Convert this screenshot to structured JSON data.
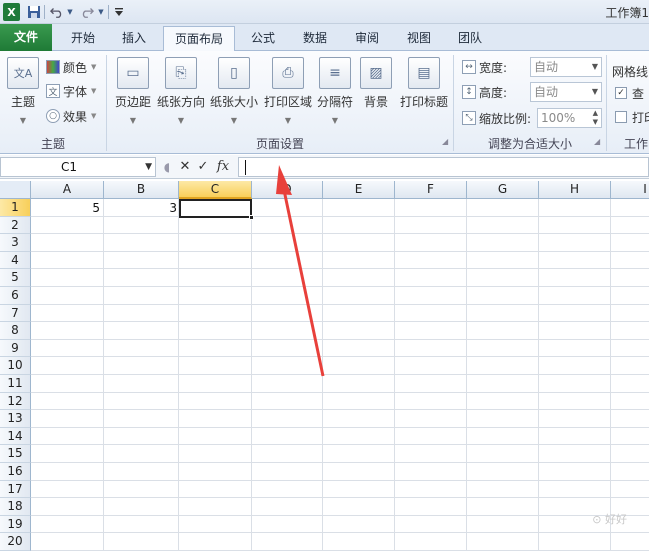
{
  "window": {
    "title": "工作簿1"
  },
  "quick_access": {
    "app_icon": "X",
    "save_icon": "save-icon",
    "undo_icon": "undo-icon",
    "redo_icon": "redo-icon"
  },
  "tabs": [
    {
      "label": "文件"
    },
    {
      "label": "开始"
    },
    {
      "label": "插入"
    },
    {
      "label": "页面布局"
    },
    {
      "label": "公式"
    },
    {
      "label": "数据"
    },
    {
      "label": "审阅"
    },
    {
      "label": "视图"
    },
    {
      "label": "团队"
    }
  ],
  "ribbon": {
    "theme_group": {
      "label": "主题",
      "theme_button": "主题",
      "colors": "颜色",
      "fonts": "字体",
      "effects": "效果"
    },
    "page_setup_group": {
      "label": "页面设置",
      "margins": "页边距",
      "orientation": "纸张方向",
      "size": "纸张大小",
      "print_area": "打印区域",
      "breaks": "分隔符",
      "background": "背景",
      "print_titles": "打印标题"
    },
    "scale_group": {
      "label": "调整为合适大小",
      "width_label": "宽度:",
      "width_value": "自动",
      "height_label": "高度:",
      "height_value": "自动",
      "scale_label": "缩放比例:",
      "scale_value": "100%"
    },
    "sheet_options_group": {
      "label": "工作",
      "gridlines_label": "网格线",
      "view_label": "查",
      "print_label": "打印"
    }
  },
  "formula_bar": {
    "name_box": "C1",
    "fx_label": "fx",
    "value": ""
  },
  "grid": {
    "columns": [
      "A",
      "B",
      "C",
      "D",
      "E",
      "F",
      "G",
      "H",
      "I"
    ],
    "rows": [
      "1",
      "2",
      "3",
      "4",
      "5",
      "6",
      "7",
      "8",
      "9",
      "10",
      "11",
      "12",
      "13",
      "14",
      "15",
      "16",
      "17",
      "18",
      "19",
      "20"
    ],
    "selected_cell": "C1",
    "cells": {
      "A1": "5",
      "B1": "3"
    }
  }
}
